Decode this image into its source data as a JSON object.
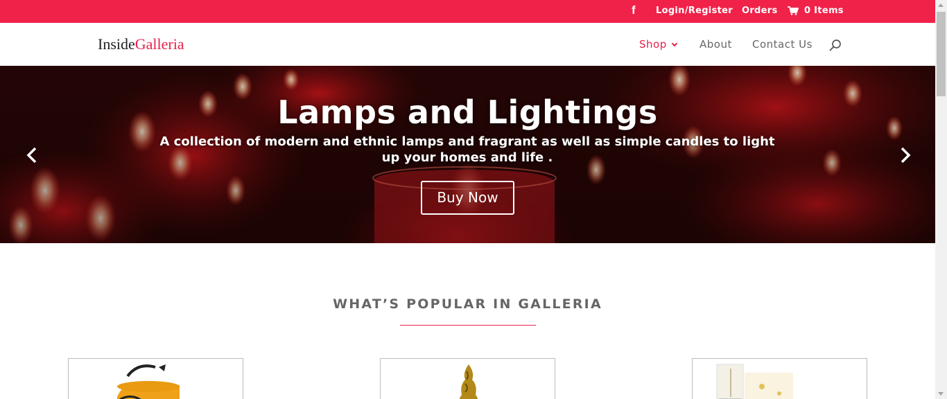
{
  "topbar": {
    "facebook_icon": "facebook-icon",
    "login": "Login/Register",
    "orders": "Orders",
    "cart_icon": "cart-icon",
    "cart": "0 Items",
    "bg_color": "#f0224a"
  },
  "header": {
    "logo_part1": "Inside",
    "logo_part2": "Galleria",
    "nav": {
      "shop": "Shop",
      "about": "About",
      "contact": "Contact Us"
    },
    "search_icon": "search-icon",
    "accent_color": "#e8204a"
  },
  "hero": {
    "title": "Lamps and Lightings",
    "subtitle": "A collection of modern and ethnic lamps and fragrant as well as simple candles to light up your homes and life .",
    "button": "Buy Now",
    "prev_icon": "chevron-left-icon",
    "next_icon": "chevron-right-icon"
  },
  "popular": {
    "title": "WHAT’S POPULAR IN GALLERIA"
  }
}
